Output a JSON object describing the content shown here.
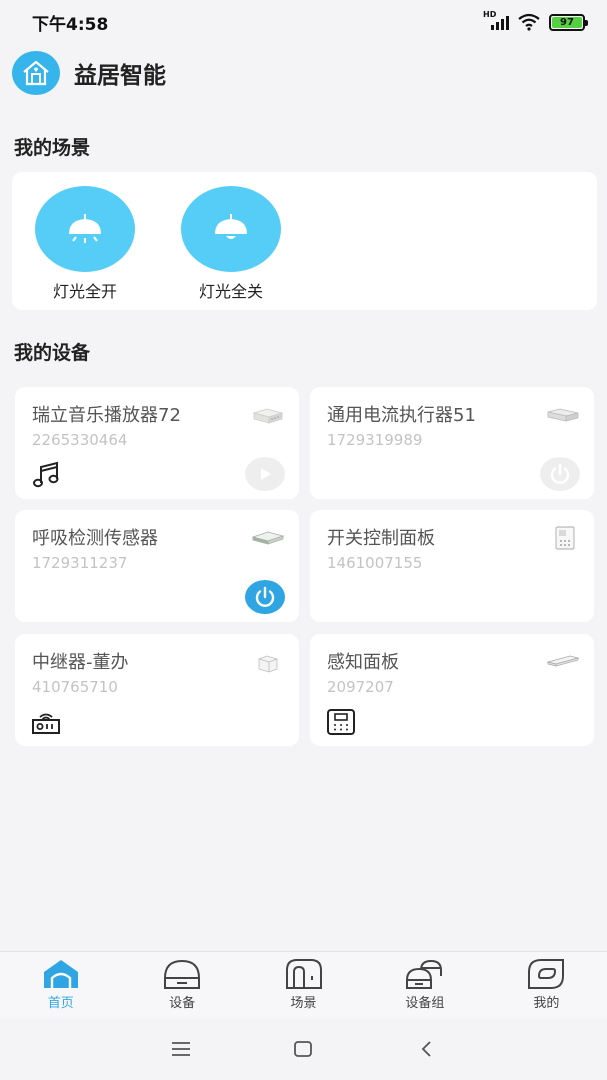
{
  "status_bar": {
    "time": "下午4:58",
    "network_label": "HD",
    "battery": "97",
    "battery_color": "#55d043"
  },
  "app": {
    "title": "益居智能",
    "accent": "#35b5ec"
  },
  "scenes": {
    "title": "我的场景",
    "items": [
      {
        "label": "灯光全开",
        "icon": "lamp-on-icon"
      },
      {
        "label": "灯光全关",
        "icon": "lamp-off-icon"
      }
    ]
  },
  "devices": {
    "title": "我的设备",
    "items": [
      {
        "name": "瑞立音乐播放器72",
        "id": "2265330464",
        "icon": "music-note-icon",
        "action": "play-icon",
        "action_active": false
      },
      {
        "name": "通用电流执行器51",
        "id": "1729319989",
        "action": "power-icon",
        "action_active": false
      },
      {
        "name": "呼吸检测传感器",
        "id": "1729311237",
        "action": "power-icon",
        "action_active": true
      },
      {
        "name": "开关控制面板",
        "id": "1461007155"
      },
      {
        "name": "中继器-董办",
        "id": "410765710",
        "icon": "router-icon"
      },
      {
        "name": "感知面板",
        "id": "2097207",
        "icon": "panel-icon"
      }
    ]
  },
  "tabs": [
    {
      "label": "首页",
      "icon": "home-icon",
      "active": true
    },
    {
      "label": "设备",
      "icon": "device-icon",
      "active": false
    },
    {
      "label": "场景",
      "icon": "scene-icon",
      "active": false
    },
    {
      "label": "设备组",
      "icon": "device-group-icon",
      "active": false
    },
    {
      "label": "我的",
      "icon": "profile-icon",
      "active": false
    }
  ],
  "system_nav": {
    "icons": [
      "menu-icon",
      "home-square-icon",
      "back-icon"
    ]
  }
}
